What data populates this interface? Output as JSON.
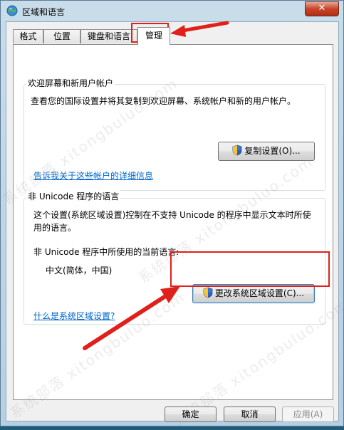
{
  "window": {
    "title": "区域和语言",
    "close_icon": "close-icon"
  },
  "tabs": [
    {
      "label": "格式",
      "active": false
    },
    {
      "label": "位置",
      "active": false
    },
    {
      "label": "键盘和语言",
      "active": false
    },
    {
      "label": "管理",
      "active": true
    }
  ],
  "welcome_group": {
    "title": "欢迎屏幕和新用户帐户",
    "description": "查看您的国际设置并将其复制到欢迎屏幕、系统帐户和新的用户帐户。",
    "copy_button": "复制设置(O)...",
    "link": "告诉我关于这些帐户的详细信息"
  },
  "unicode_group": {
    "title": "非 Unicode 程序的语言",
    "description_line1": "这个设置(系统区域设置)控制在不支持 Unicode 的程序中显示文本时所使",
    "description_line2": "用的语言。",
    "current_label": "非 Unicode 程序中所使用的当前语言:",
    "current_value": "中文(简体，中国)",
    "change_button": "更改系统区域设置(C)...",
    "link": "什么是系统区域设置?"
  },
  "footer": {
    "ok": "确定",
    "cancel": "取消",
    "apply": "应用(A)"
  },
  "watermark": "系统部落 xitongbuluo.com",
  "colors": {
    "annotation_red": "#e0201b",
    "link_blue": "#0066cc"
  }
}
